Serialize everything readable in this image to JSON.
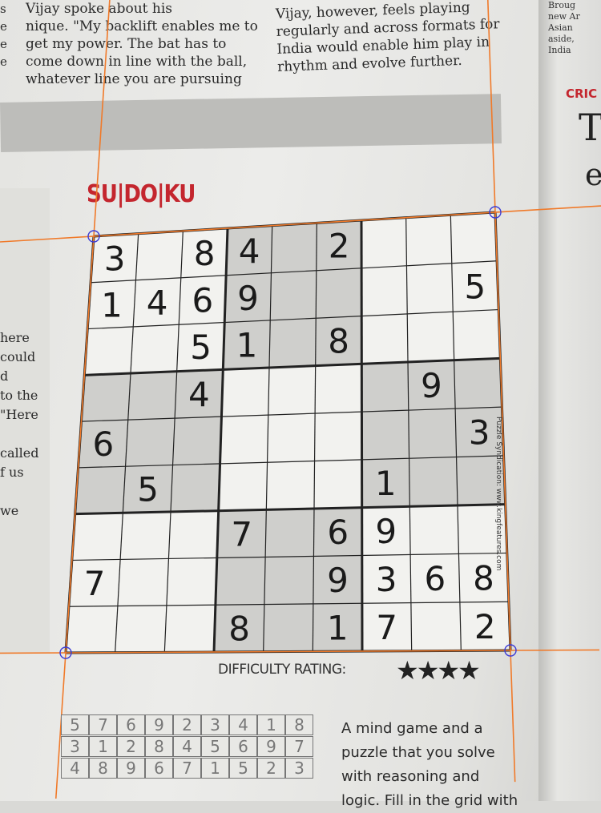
{
  "article_left": [
    "Vijay spoke about his",
    "nique. \"My backlift enables me to",
    "get my power. The bat has to",
    "come down in line with the ball,",
    "whatever line you are pursuing"
  ],
  "article_right": [
    "Vijay, however, feels playing",
    "regularly and across formats for",
    "India would enable him play in",
    "rhythm and evolve further."
  ],
  "left_edge_letters": [
    "s",
    "e",
    "e",
    "e"
  ],
  "left_snippet": [
    "here",
    "could",
    "d",
    "to the",
    "\"Here",
    "",
    "called",
    "f us",
    "",
    "we"
  ],
  "right_column_snippet": [
    "Broug",
    "new Ar",
    "Asian",
    "aside,",
    "India"
  ],
  "right_header": "CRIC",
  "right_big_letter": "T",
  "right_big_letter_2": "e",
  "sudoku_title": "SU|DO|KU",
  "puzzle": [
    [
      "3",
      "",
      "8",
      "4",
      "",
      "2",
      "",
      "",
      ""
    ],
    [
      "1",
      "4",
      "6",
      "9",
      "",
      "",
      "",
      "",
      "5"
    ],
    [
      "",
      "",
      "5",
      "1",
      "",
      "8",
      "",
      "",
      ""
    ],
    [
      "",
      "",
      "4",
      "",
      "",
      "",
      "",
      "9",
      ""
    ],
    [
      "6",
      "",
      "",
      "",
      "",
      "",
      "",
      "",
      "3"
    ],
    [
      "",
      "5",
      "",
      "",
      "",
      "",
      "1",
      "",
      ""
    ],
    [
      "",
      "",
      "",
      "7",
      "",
      "6",
      "9",
      "",
      ""
    ],
    [
      "7",
      "",
      "",
      "",
      "",
      "9",
      "3",
      "6",
      "8"
    ],
    [
      "",
      "",
      "",
      "8",
      "",
      "1",
      "7",
      "",
      "2"
    ]
  ],
  "copyright": "Puzzle Syndication: www.kingfeatures.com",
  "difficulty_label": "DIFFICULTY RATING:",
  "difficulty_stars": 4,
  "solution_rows": [
    [
      "5",
      "7",
      "6",
      "9",
      "2",
      "3",
      "4",
      "1",
      "8"
    ],
    [
      "3",
      "1",
      "2",
      "8",
      "4",
      "5",
      "6",
      "9",
      "7"
    ],
    [
      "4",
      "8",
      "9",
      "6",
      "7",
      "1",
      "5",
      "2",
      "3"
    ]
  ],
  "explain_lines": [
    "A mind game and a",
    "puzzle that you solve",
    "with reasoning and",
    "logic. Fill in the grid with"
  ],
  "colors": {
    "accent_red": "#c4262e",
    "guide_orange": "#f07a2a"
  }
}
